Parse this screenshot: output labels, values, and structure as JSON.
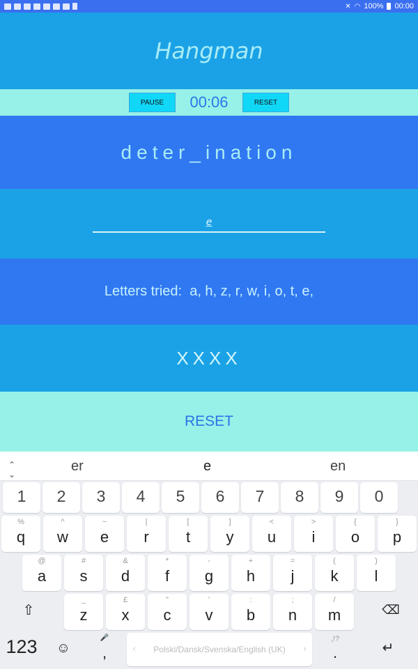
{
  "status_bar": {
    "notification_icons": [
      "youtube-icon",
      "youtube-icon",
      "youtube-icon",
      "youtube-icon",
      "youtube-icon",
      "image-icon",
      "keyboard-icon",
      "trash-icon"
    ],
    "battery": "100%",
    "time": "00:00"
  },
  "app": {
    "title": "Hangman",
    "pause_label": "PAUSE",
    "timer": "00:06",
    "reset_small_label": "RESET",
    "word": "deter_ination",
    "input_value": "e",
    "letters_tried": "Letters tried:  a, h, z, r, w, i, o, t, e,",
    "misses": "XXXX",
    "reset_label": "RESET"
  },
  "suggestions": [
    "er",
    "e",
    "en"
  ],
  "keyboard": {
    "number_row": [
      "1",
      "2",
      "3",
      "4",
      "5",
      "6",
      "7",
      "8",
      "9",
      "0"
    ],
    "row1": [
      {
        "main": "q",
        "sub": "%"
      },
      {
        "main": "w",
        "sub": "^"
      },
      {
        "main": "e",
        "sub": "~"
      },
      {
        "main": "r",
        "sub": "|"
      },
      {
        "main": "t",
        "sub": "["
      },
      {
        "main": "y",
        "sub": "]"
      },
      {
        "main": "u",
        "sub": "<"
      },
      {
        "main": "i",
        "sub": ">"
      },
      {
        "main": "o",
        "sub": "{"
      },
      {
        "main": "p",
        "sub": "}"
      }
    ],
    "row2": [
      {
        "main": "a",
        "sub": "@"
      },
      {
        "main": "s",
        "sub": "#"
      },
      {
        "main": "d",
        "sub": "&"
      },
      {
        "main": "f",
        "sub": "*"
      },
      {
        "main": "g",
        "sub": "-"
      },
      {
        "main": "h",
        "sub": "+"
      },
      {
        "main": "j",
        "sub": "="
      },
      {
        "main": "k",
        "sub": "("
      },
      {
        "main": "l",
        "sub": ")"
      }
    ],
    "row3": [
      {
        "main": "z",
        "sub": "_"
      },
      {
        "main": "x",
        "sub": "£"
      },
      {
        "main": "c",
        "sub": "\""
      },
      {
        "main": "v",
        "sub": "'"
      },
      {
        "main": "b",
        "sub": ":"
      },
      {
        "main": "n",
        "sub": ";"
      },
      {
        "main": "m",
        "sub": "/"
      }
    ],
    "symbols_key": "123",
    "emoji_glyph": "☺",
    "comma": ",",
    "space_label": "Polski/Dansk/Svenska/English (UK)",
    "period": ".",
    "period_sub": ",!?",
    "shift_glyph": "⇧",
    "backspace_glyph": "⌫",
    "enter_glyph": "↵"
  }
}
